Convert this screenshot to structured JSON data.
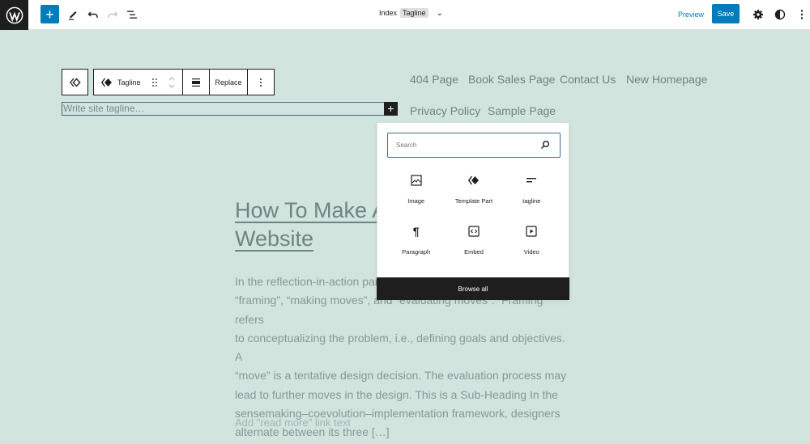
{
  "topbar": {
    "logo_icon": "wordpress-logo-icon",
    "add_block_label": "+",
    "document": {
      "label": "Index",
      "template": "Tagline"
    },
    "preview_label": "Preview",
    "save_label": "Save",
    "accent_color": "#007cba"
  },
  "block_toolbar": {
    "block_name": "Tagline",
    "replace_label": "Replace"
  },
  "tagline_placeholder": "Write site tagline…",
  "nav": {
    "links": [
      "404 Page",
      "Book Sales Page",
      "Contact Us",
      "New Homepage",
      "Privacy Policy",
      "Sample Page"
    ]
  },
  "post": {
    "title_line1": "How To Make A",
    "title_line2": "Website",
    "excerpt_lines": [
      "In the reflection-in-action paradigm, designers alternate between",
      "“framing”, “making moves”, and “evaluating moves”. “Framing” refers",
      "to conceptualizing the problem, i.e., defining goals and objectives. A",
      "“move” is a tentative design decision. The evaluation process may",
      "lead to further moves in the design. This is a Sub-Heading In the",
      "sensemaking–coevolution–implementation framework, designers",
      "alternate between its three […]"
    ],
    "read_more_placeholder": "Add \"read more\" link text"
  },
  "inserter": {
    "search_placeholder": "Search",
    "blocks": [
      {
        "label": "Image",
        "icon": "image-icon"
      },
      {
        "label": "Template Part",
        "icon": "template-part-icon"
      },
      {
        "label": "tagline",
        "icon": "tagline-icon"
      },
      {
        "label": "Paragraph",
        "icon": "paragraph-icon"
      },
      {
        "label": "Embed",
        "icon": "embed-icon"
      },
      {
        "label": "Video",
        "icon": "video-icon"
      }
    ],
    "browse_all_label": "Browse all"
  }
}
